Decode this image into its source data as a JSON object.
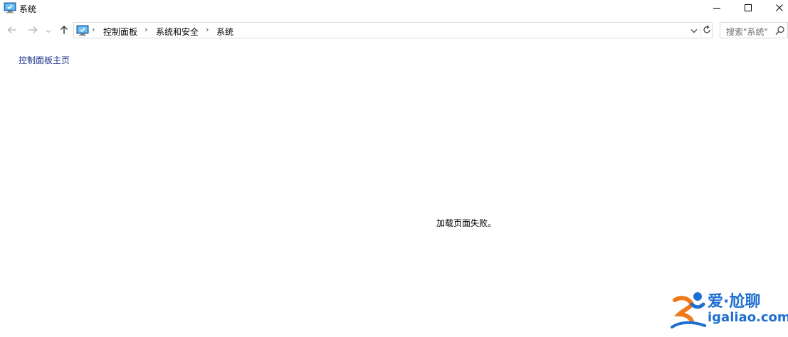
{
  "window": {
    "title": "系统",
    "controls": {
      "minimize": "minimize-icon",
      "maximize": "maximize-icon",
      "close": "close-icon"
    }
  },
  "nav": {
    "back_icon": "arrow-left-icon",
    "forward_icon": "arrow-right-icon",
    "recent_icon": "chevron-down-icon",
    "up_icon": "arrow-up-icon"
  },
  "address": {
    "separator": "›",
    "breadcrumbs": [
      "控制面板",
      "系统和安全",
      "系统"
    ]
  },
  "search": {
    "placeholder": "搜索\"系统\""
  },
  "sidebar": {
    "home_link": "控制面板主页"
  },
  "content": {
    "error_message": "加载页面失败。"
  },
  "watermark": {
    "title": "爱·尬聊",
    "url": "igaliao.com"
  },
  "colors": {
    "link": "#1e3287",
    "border": "#d9d9d9",
    "watermark_blue": "#1f6fd1",
    "watermark_orange": "#f07a1a"
  }
}
